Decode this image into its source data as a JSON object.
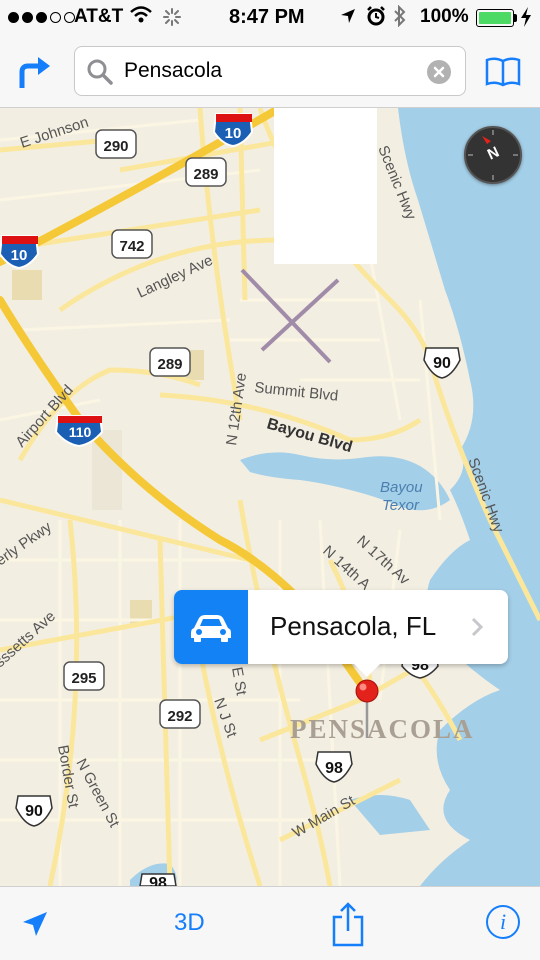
{
  "status_bar": {
    "carrier": "AT&T",
    "time": "8:47 PM",
    "battery_percent": "100%",
    "signal_bars_filled": 3,
    "signal_bars_total": 5,
    "battery_level": 1.0
  },
  "nav": {
    "directions_icon": "turn-right-arrow-icon",
    "search_value": "Pensacola",
    "bookmarks_icon": "book-icon"
  },
  "map": {
    "compass_label": "N",
    "roads": {
      "e_johnson": "E Johnson",
      "langley_ave": "Langley Ave",
      "scenic_hwy_top": "Scenic Hwy",
      "scenic_hwy_bottom": "Scenic Hwy",
      "summit_blvd": "Summit Blvd",
      "airport_blvd": "Airport Blvd",
      "bayou_blvd": "Bayou Blvd",
      "n_12th_ave": "N 12th Ave",
      "n_17th_ave": "N 17th Av",
      "n_14th": "N 14th A",
      "w_perly_pkwy": "erly Pkwy",
      "massetts_ave": "sssetts Ave",
      "e_st": "E St",
      "n_j_st": "N J St",
      "n_green_st": "N Green St",
      "border_st": "Border St",
      "w_main_st": "W Main St"
    },
    "water": {
      "bayou_texor": "Bayou\nTexor",
      "bayou_texor_line1": "Bayou",
      "bayou_texor_line2": "Texor"
    },
    "shields": {
      "i10_a": "10",
      "i10_b": "10",
      "i110": "110",
      "s290": "290",
      "s289_a": "289",
      "s289_b": "289",
      "s742": "742",
      "s295": "295",
      "s292": "292",
      "us90_a": "90",
      "us90_b": "90",
      "us98_a": "98",
      "us98_b": "98",
      "us98_c": "98"
    },
    "city_label": "PENSACOLA"
  },
  "callout": {
    "title": "Pensacola, FL",
    "car_icon": "car-icon",
    "chevron_icon": "chevron-right-icon"
  },
  "toolbar": {
    "three_d_label": "3D",
    "track_icon": "location-arrow-icon",
    "share_icon": "share-icon",
    "info_label": "i"
  },
  "colors": {
    "accent": "#157efb",
    "water": "#a4cfe8",
    "major_road": "#f5c837",
    "minor_road": "#fbe79b",
    "pin": "#e3221b",
    "land": "#f3eee2"
  }
}
